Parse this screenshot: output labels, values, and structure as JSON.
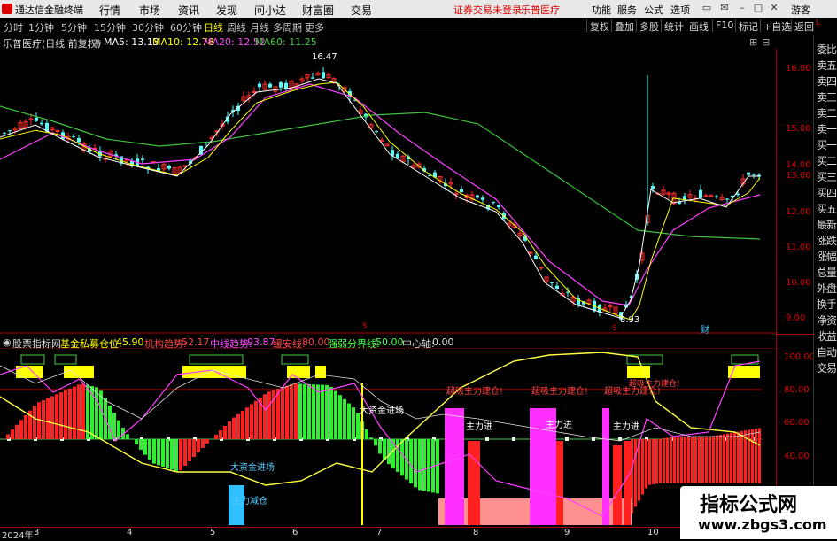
{
  "menubar": {
    "app_name": "通达信金融终端",
    "items": [
      "行情",
      "市场",
      "资讯",
      "发现",
      "问小达",
      "财富圈",
      "交易"
    ],
    "warning": "证券交易未登录",
    "stock_link": "乐普医疗",
    "right_items": [
      "功能",
      "服务",
      "公式",
      "选项"
    ],
    "guest": "游客"
  },
  "toolbar": {
    "periods": [
      "分时",
      "1分钟",
      "5分钟",
      "15分钟",
      "30分钟",
      "60分钟",
      "日线",
      "周线",
      "月线",
      "多周期",
      "更多"
    ],
    "active": "日线",
    "right_buttons": [
      "复权",
      "叠加",
      "多股",
      "统计",
      "画线",
      "F10",
      "标记",
      "+自选",
      "返回"
    ]
  },
  "info": {
    "title": "乐普医疗(日线 前复权)",
    "ma5": "MA5: 13.13",
    "ma10": "MA10: 12.78",
    "ma20": "MA20: 12.52",
    "ma60": "MA60: 11.25"
  },
  "price_axis": [
    "16.00",
    "15.00",
    "14.00",
    "13.00",
    "12.00",
    "11.00",
    "10.00",
    "9.00"
  ],
  "price_annotations": {
    "high": "16.47",
    "low": "8.93",
    "marker_cai": "财",
    "marker_s": "S"
  },
  "indicator": {
    "name": "股票指标网",
    "items": [
      {
        "label": "基金私募仓位:",
        "value": "45.90",
        "color": "#ffff00"
      },
      {
        "label": "机构趋势:",
        "value": "52.17",
        "color": "#ff4040"
      },
      {
        "label": "中线趋势:",
        "value": "93.87",
        "color": "#ff40ff"
      },
      {
        "label": "缓安线:",
        "value": "80.00",
        "color": "#ff4040"
      },
      {
        "label": "强弱分界线:",
        "value": "50.00",
        "color": "#40ff40"
      },
      {
        "label": "中心轴:",
        "value": "0.00",
        "color": "#dddddd"
      }
    ]
  },
  "indicator_axis": [
    "100.00",
    "80.00",
    "60.00",
    "40.00"
  ],
  "indicator_annotations": {
    "big_fund_in_1": "大资金进场",
    "big_fund_in_2": "大资金进场",
    "main_reduce": "主力减仓",
    "main_in_1": "主力进",
    "main_in_2": "主力进",
    "main_in_3": "主力进",
    "suck_1": "超吸主力建仓!",
    "suck_2": "超吸主力建仓!",
    "suck_3": "超吸主力建仓!",
    "suck_4": "超吸主力建仓!"
  },
  "xaxis": {
    "labels": [
      "2024年",
      "3",
      "4",
      "5",
      "6",
      "7",
      "8",
      "9",
      "10"
    ]
  },
  "sidebar": [
    "委比",
    "卖五",
    "卖四",
    "卖三",
    "卖二",
    "卖一",
    "买一",
    "买二",
    "买三",
    "买四",
    "买五",
    "最新",
    "涨跌",
    "涨幅",
    "总量",
    "外盘",
    "换手",
    "净资",
    "收益",
    "自动",
    "交易"
  ],
  "watermark": {
    "line1": "指标公式网",
    "line2": "www.zbgs3.com"
  },
  "colors": {
    "up": "#ff3030",
    "down": "#54ffff",
    "ma5": "#ffffff",
    "ma10": "#ffff00",
    "ma20": "#ff40ff",
    "ma60": "#40c040"
  }
}
